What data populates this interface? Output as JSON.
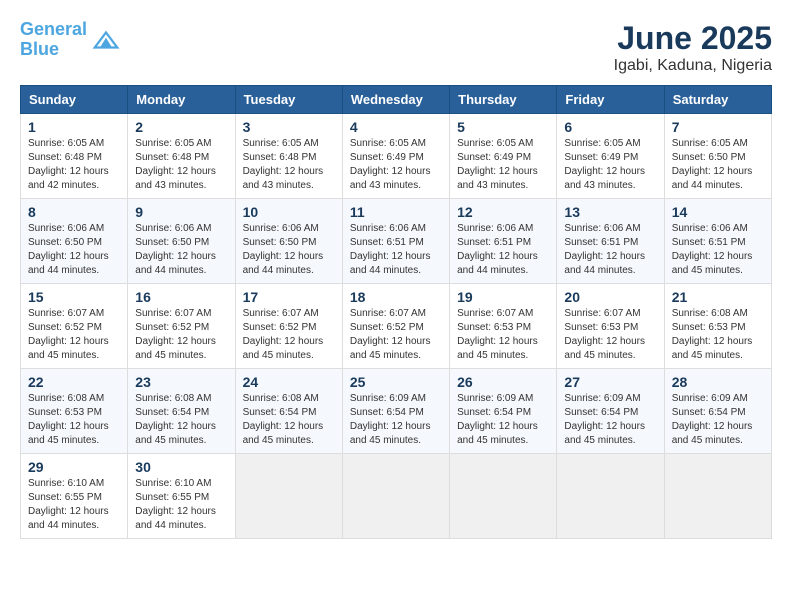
{
  "header": {
    "logo_line1": "General",
    "logo_line2": "Blue",
    "title": "June 2025",
    "subtitle": "Igabi, Kaduna, Nigeria"
  },
  "days_of_week": [
    "Sunday",
    "Monday",
    "Tuesday",
    "Wednesday",
    "Thursday",
    "Friday",
    "Saturday"
  ],
  "weeks": [
    [
      {
        "day": "1",
        "sunrise": "6:05 AM",
        "sunset": "6:48 PM",
        "daylight": "12 hours and 42 minutes."
      },
      {
        "day": "2",
        "sunrise": "6:05 AM",
        "sunset": "6:48 PM",
        "daylight": "12 hours and 43 minutes."
      },
      {
        "day": "3",
        "sunrise": "6:05 AM",
        "sunset": "6:48 PM",
        "daylight": "12 hours and 43 minutes."
      },
      {
        "day": "4",
        "sunrise": "6:05 AM",
        "sunset": "6:49 PM",
        "daylight": "12 hours and 43 minutes."
      },
      {
        "day": "5",
        "sunrise": "6:05 AM",
        "sunset": "6:49 PM",
        "daylight": "12 hours and 43 minutes."
      },
      {
        "day": "6",
        "sunrise": "6:05 AM",
        "sunset": "6:49 PM",
        "daylight": "12 hours and 43 minutes."
      },
      {
        "day": "7",
        "sunrise": "6:05 AM",
        "sunset": "6:50 PM",
        "daylight": "12 hours and 44 minutes."
      }
    ],
    [
      {
        "day": "8",
        "sunrise": "6:06 AM",
        "sunset": "6:50 PM",
        "daylight": "12 hours and 44 minutes."
      },
      {
        "day": "9",
        "sunrise": "6:06 AM",
        "sunset": "6:50 PM",
        "daylight": "12 hours and 44 minutes."
      },
      {
        "day": "10",
        "sunrise": "6:06 AM",
        "sunset": "6:50 PM",
        "daylight": "12 hours and 44 minutes."
      },
      {
        "day": "11",
        "sunrise": "6:06 AM",
        "sunset": "6:51 PM",
        "daylight": "12 hours and 44 minutes."
      },
      {
        "day": "12",
        "sunrise": "6:06 AM",
        "sunset": "6:51 PM",
        "daylight": "12 hours and 44 minutes."
      },
      {
        "day": "13",
        "sunrise": "6:06 AM",
        "sunset": "6:51 PM",
        "daylight": "12 hours and 44 minutes."
      },
      {
        "day": "14",
        "sunrise": "6:06 AM",
        "sunset": "6:51 PM",
        "daylight": "12 hours and 45 minutes."
      }
    ],
    [
      {
        "day": "15",
        "sunrise": "6:07 AM",
        "sunset": "6:52 PM",
        "daylight": "12 hours and 45 minutes."
      },
      {
        "day": "16",
        "sunrise": "6:07 AM",
        "sunset": "6:52 PM",
        "daylight": "12 hours and 45 minutes."
      },
      {
        "day": "17",
        "sunrise": "6:07 AM",
        "sunset": "6:52 PM",
        "daylight": "12 hours and 45 minutes."
      },
      {
        "day": "18",
        "sunrise": "6:07 AM",
        "sunset": "6:52 PM",
        "daylight": "12 hours and 45 minutes."
      },
      {
        "day": "19",
        "sunrise": "6:07 AM",
        "sunset": "6:53 PM",
        "daylight": "12 hours and 45 minutes."
      },
      {
        "day": "20",
        "sunrise": "6:07 AM",
        "sunset": "6:53 PM",
        "daylight": "12 hours and 45 minutes."
      },
      {
        "day": "21",
        "sunrise": "6:08 AM",
        "sunset": "6:53 PM",
        "daylight": "12 hours and 45 minutes."
      }
    ],
    [
      {
        "day": "22",
        "sunrise": "6:08 AM",
        "sunset": "6:53 PM",
        "daylight": "12 hours and 45 minutes."
      },
      {
        "day": "23",
        "sunrise": "6:08 AM",
        "sunset": "6:54 PM",
        "daylight": "12 hours and 45 minutes."
      },
      {
        "day": "24",
        "sunrise": "6:08 AM",
        "sunset": "6:54 PM",
        "daylight": "12 hours and 45 minutes."
      },
      {
        "day": "25",
        "sunrise": "6:09 AM",
        "sunset": "6:54 PM",
        "daylight": "12 hours and 45 minutes."
      },
      {
        "day": "26",
        "sunrise": "6:09 AM",
        "sunset": "6:54 PM",
        "daylight": "12 hours and 45 minutes."
      },
      {
        "day": "27",
        "sunrise": "6:09 AM",
        "sunset": "6:54 PM",
        "daylight": "12 hours and 45 minutes."
      },
      {
        "day": "28",
        "sunrise": "6:09 AM",
        "sunset": "6:54 PM",
        "daylight": "12 hours and 45 minutes."
      }
    ],
    [
      {
        "day": "29",
        "sunrise": "6:10 AM",
        "sunset": "6:55 PM",
        "daylight": "12 hours and 44 minutes."
      },
      {
        "day": "30",
        "sunrise": "6:10 AM",
        "sunset": "6:55 PM",
        "daylight": "12 hours and 44 minutes."
      },
      null,
      null,
      null,
      null,
      null
    ]
  ],
  "labels": {
    "sunrise_prefix": "Sunrise: ",
    "sunset_prefix": "Sunset: ",
    "daylight_prefix": "Daylight: "
  }
}
